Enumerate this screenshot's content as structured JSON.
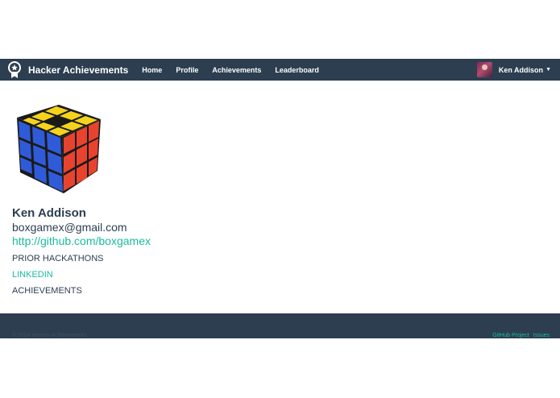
{
  "navbar": {
    "brand_icon": "award-ribbon-icon",
    "brand_name": "Hacker Achievements",
    "links": [
      {
        "label": "Home"
      },
      {
        "label": "Profile"
      },
      {
        "label": "Achievements"
      },
      {
        "label": "Leaderboard"
      }
    ],
    "user": {
      "name": "Ken Addison",
      "caret_icon": "caret-down-icon"
    }
  },
  "profile": {
    "image": "rubiks-cube-image",
    "name": "Ken Addison",
    "email": "boxgamex@gmail.com",
    "github_url": "http://github.com/boxgamex",
    "sections": [
      {
        "label": "PRIOR HACKATHONS"
      },
      {
        "label": "LINKEDIN"
      },
      {
        "label": "ACHIEVEMENTS"
      }
    ]
  },
  "footer": {
    "copyright": "© 2014 Hacker Achievements",
    "links": [
      {
        "label": "GitHub Project"
      },
      {
        "label": "Issues"
      }
    ]
  },
  "colors": {
    "navbar": "#2c3e50",
    "accent": "#18bc9c",
    "text": "#2c3e50"
  }
}
